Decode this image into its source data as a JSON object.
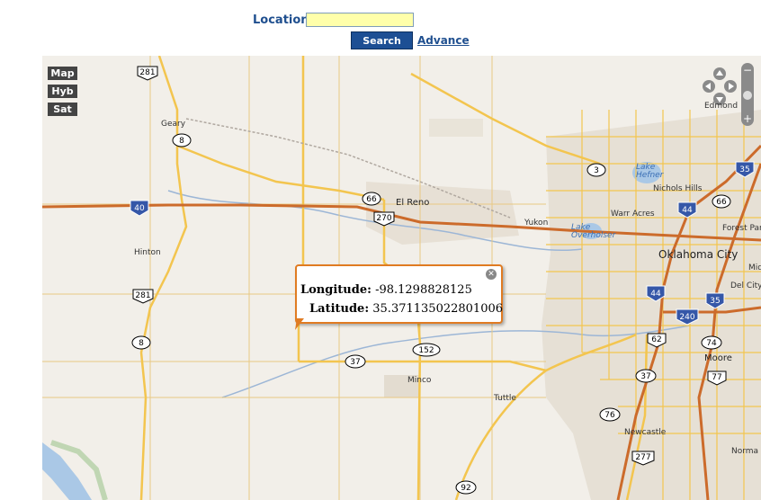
{
  "search": {
    "label": "Location",
    "value": "",
    "button": "Search",
    "advance": "Advance"
  },
  "map_types": [
    "Map",
    "Hyb",
    "Sat"
  ],
  "popup": {
    "longitude_label": "Longitude:",
    "longitude_value": "-98.1298828125",
    "latitude_label": "Latitude:",
    "latitude_value": "35.371135022801006"
  },
  "places": {
    "geary": "Geary",
    "el_reno": "El Reno",
    "yukon": "Yukon",
    "hinton": "Hinton",
    "minco": "Minco",
    "tuttle": "Tuttle",
    "newcastle": "Newcastle",
    "moore": "Moore",
    "oklahoma_city": "Oklahoma City",
    "warr_acres": "Warr Acres",
    "nichols_hills": "Nichols Hills",
    "edmond": "Edmond",
    "forest_park": "Forest Par",
    "midwest": "Mid",
    "del_city": "Del City",
    "norman": "Norma"
  },
  "lakes": {
    "hefner_1": "Lake",
    "hefner_2": "Hefner",
    "overholser_1": "Lake",
    "overholser_2": "Overholser"
  },
  "shields": {
    "us281_top": "281",
    "sh8_top": "8",
    "i40": "40",
    "us281_mid": "281",
    "sh8_bottom": "8",
    "sh66": "66",
    "us270": "270",
    "sh3": "3",
    "i44_north": "44",
    "sh66_east": "66",
    "i35_north": "35",
    "i44_south": "44",
    "i35_south": "35",
    "i240": "240",
    "sh152": "152",
    "sh37_west": "37",
    "us62": "62",
    "sh74": "74",
    "us77": "77",
    "sh37_east": "37",
    "sh76": "76",
    "us277": "277",
    "sh92": "92"
  },
  "colors": {
    "highway": "#f3c54f",
    "interstate": "#cc6b2b",
    "land": "#f2efe9",
    "urban": "#ddd4c5",
    "water": "#aac8e6"
  }
}
